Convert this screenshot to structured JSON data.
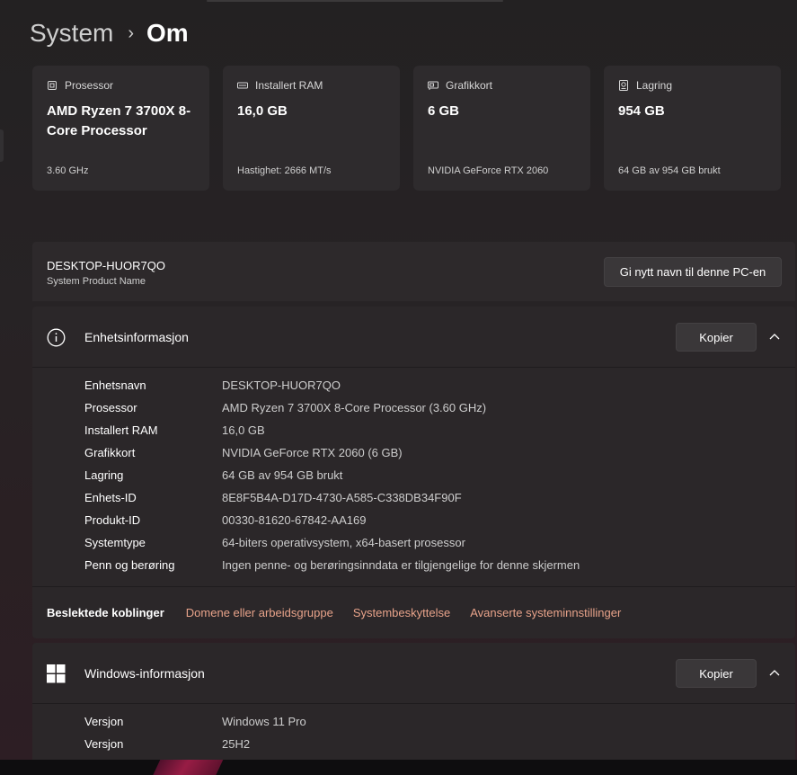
{
  "breadcrumb": {
    "parent": "System",
    "separator": "›",
    "current": "Om"
  },
  "cards": [
    {
      "label": "Prosessor",
      "icon": "processor-icon",
      "value": "AMD Ryzen 7 3700X 8-Core Processor",
      "sub": "3.60 GHz"
    },
    {
      "label": "Installert RAM",
      "icon": "ram-icon",
      "value": "16,0 GB",
      "sub": "Hastighet: 2666 MT/s"
    },
    {
      "label": "Grafikkort",
      "icon": "gpu-icon",
      "value": "6 GB",
      "sub": "NVIDIA GeForce RTX 2060"
    },
    {
      "label": "Lagring",
      "icon": "storage-icon",
      "value": "954 GB",
      "sub": "64 GB av 954 GB brukt"
    }
  ],
  "device_name_panel": {
    "name": "DESKTOP-HUOR7QO",
    "subtitle": "System Product Name",
    "rename_label": "Gi nytt navn til denne PC-en"
  },
  "device_info": {
    "title": "Enhetsinformasjon",
    "copy_label": "Kopier",
    "rows": [
      {
        "key": "Enhetsnavn",
        "value": "DESKTOP-HUOR7QO"
      },
      {
        "key": "Prosessor",
        "value": "AMD Ryzen 7 3700X 8-Core Processor (3.60 GHz)"
      },
      {
        "key": "Installert RAM",
        "value": "16,0 GB"
      },
      {
        "key": "Grafikkort",
        "value": "NVIDIA GeForce RTX 2060 (6 GB)"
      },
      {
        "key": "Lagring",
        "value": "64 GB av 954 GB brukt"
      },
      {
        "key": "Enhets-ID",
        "value": "8E8F5B4A-D17D-4730-A585-C338DB34F90F"
      },
      {
        "key": "Produkt-ID",
        "value": "00330-81620-67842-AA169"
      },
      {
        "key": "Systemtype",
        "value": "64-biters operativsystem, x64-basert prosessor"
      },
      {
        "key": "Penn og berøring",
        "value": "Ingen penne- og berøringsinndata er tilgjengelige for denne skjermen"
      }
    ],
    "related_label": "Beslektede koblinger",
    "related_links": [
      "Domene eller arbeidsgruppe",
      "Systembeskyttelse",
      "Avanserte systeminnstillinger"
    ]
  },
  "windows_info": {
    "title": "Windows-informasjon",
    "copy_label": "Kopier",
    "rows": [
      {
        "key": "Versjon",
        "value": "Windows 11 Pro"
      },
      {
        "key": "Versjon",
        "value": "25H2"
      }
    ]
  },
  "colors": {
    "accent_link": "#e8a38a",
    "background": "#232122",
    "card": "#2e2b2d"
  }
}
